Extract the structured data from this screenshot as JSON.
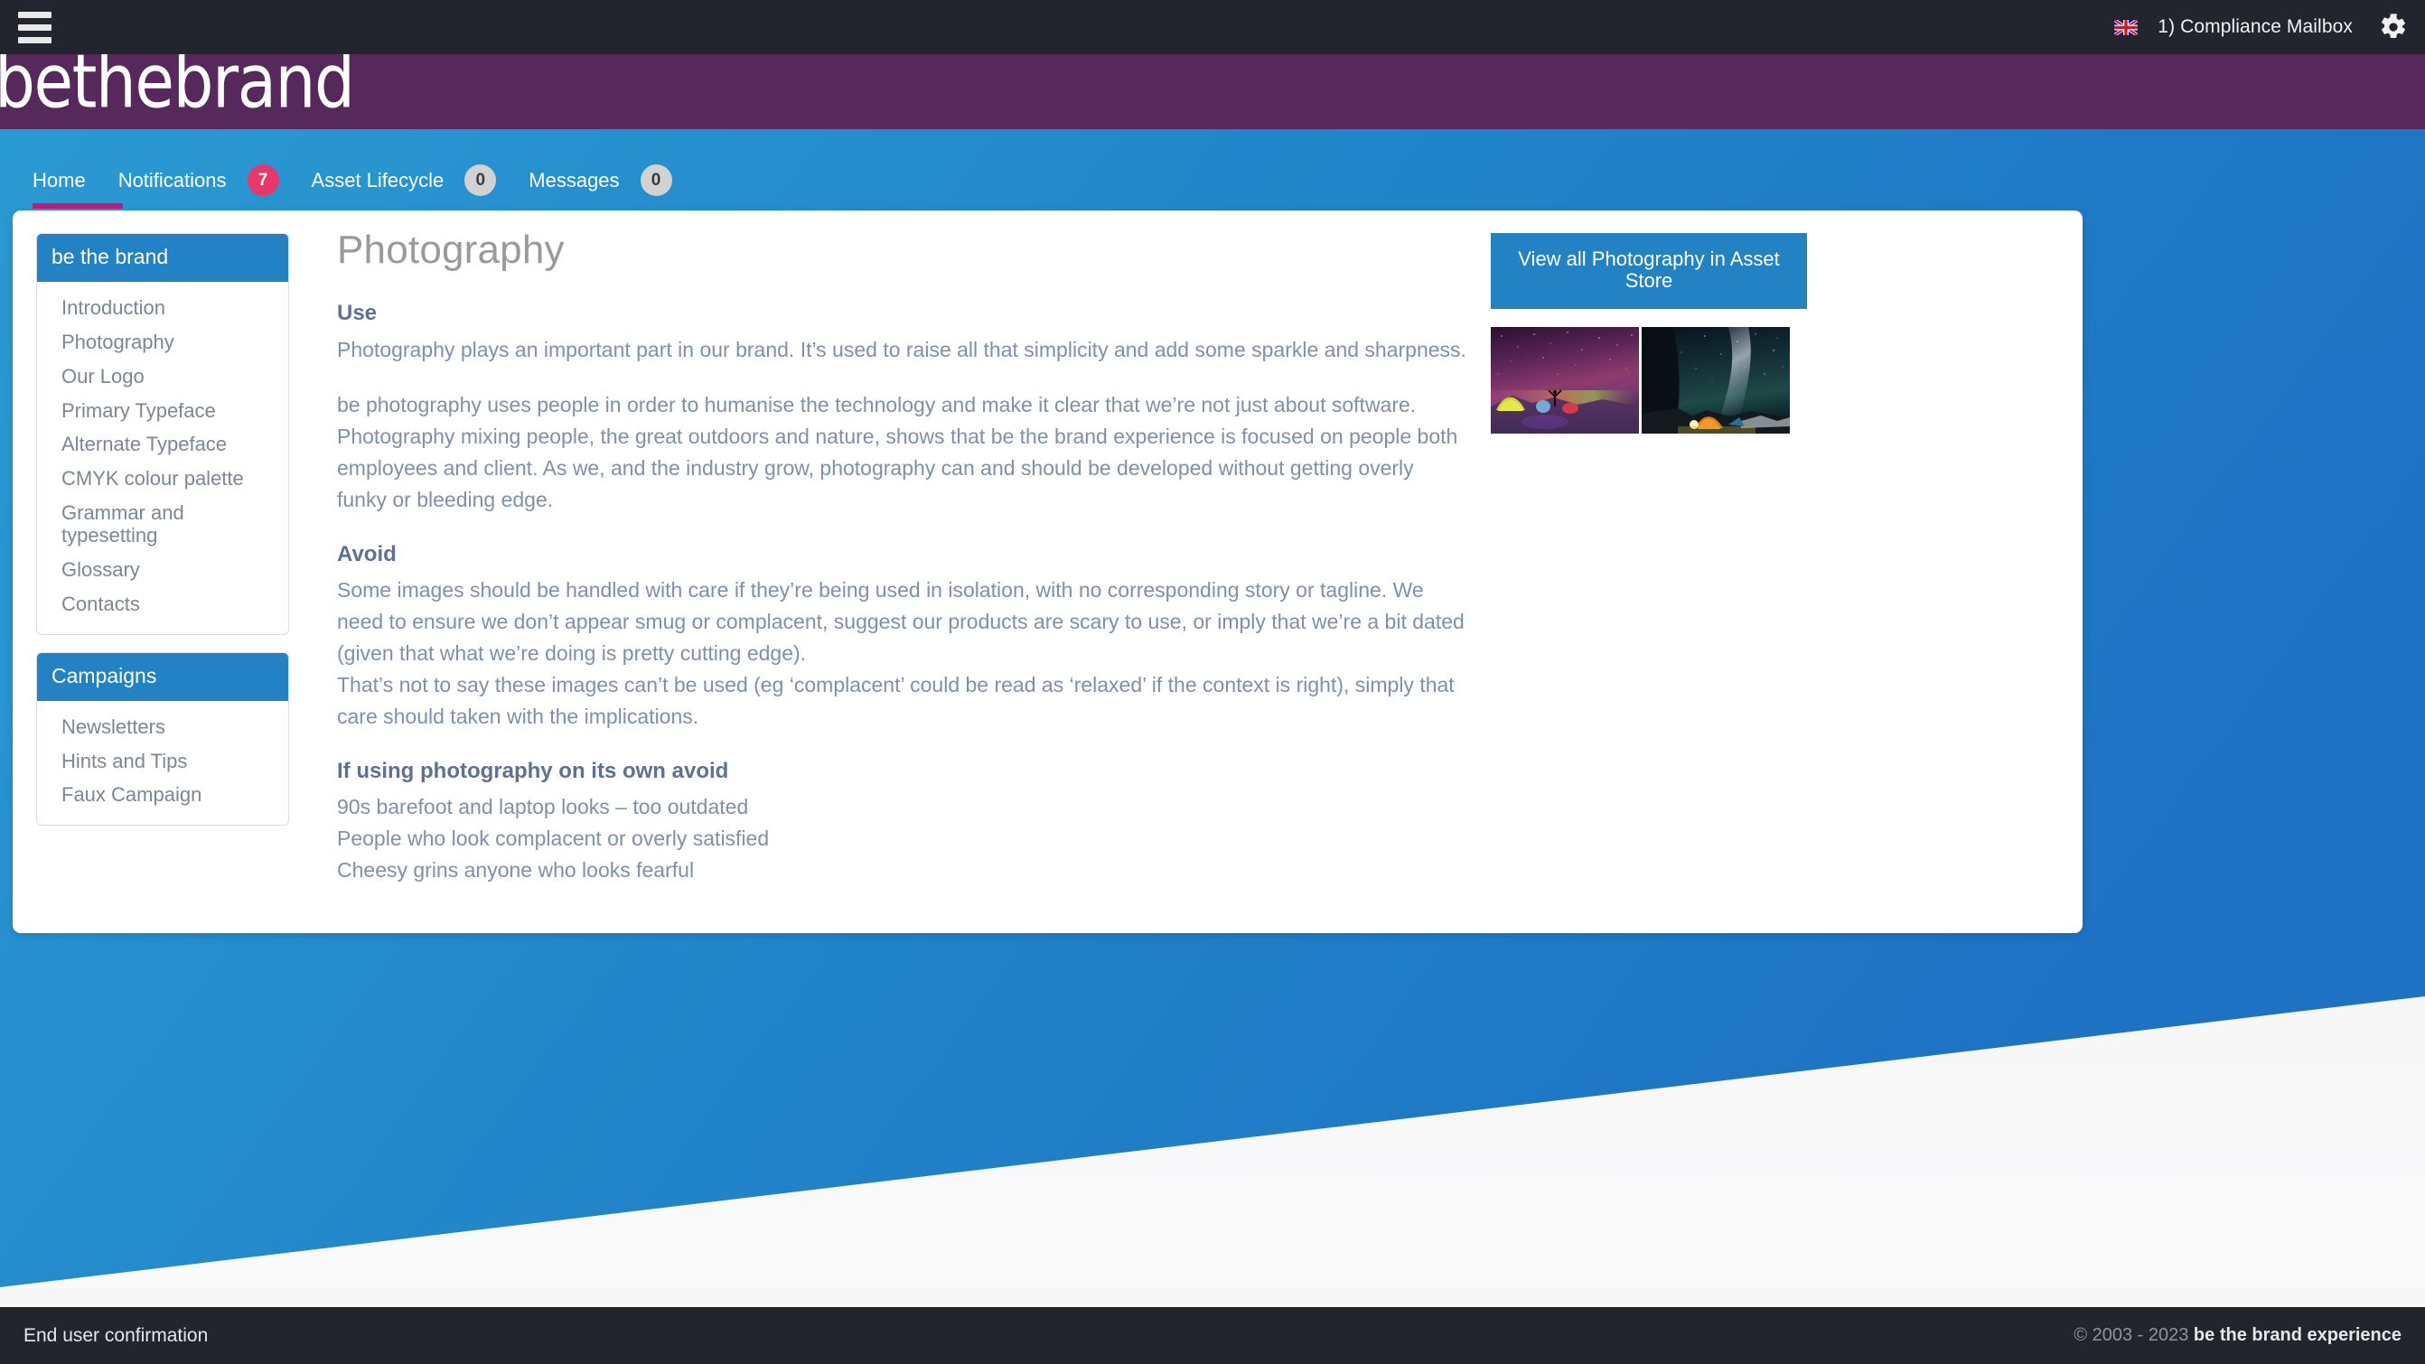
{
  "topbar": {
    "menu_icon": "hamburger-icon",
    "language": "en-GB",
    "mailbox_label": "1) Compliance Mailbox",
    "settings_icon": "gear-icon"
  },
  "brand": {
    "logo_text": "bethebrand",
    "brand_color": "#57285c"
  },
  "nav": {
    "accent_color": "#2a93d0",
    "active_underline_color": "#c0197d",
    "tabs": [
      {
        "label": "Home",
        "badge": null,
        "badge_style": "none",
        "active": true
      },
      {
        "label": "Notifications",
        "badge": "7",
        "badge_style": "pink",
        "active": false
      },
      {
        "label": "Asset Lifecycle",
        "badge": "0",
        "badge_style": "grey",
        "active": false
      },
      {
        "label": "Messages",
        "badge": "0",
        "badge_style": "grey",
        "active": false
      }
    ]
  },
  "sidebar": {
    "groups": [
      {
        "title": "be the brand",
        "items": [
          "Introduction",
          "Photography",
          "Our Logo",
          "Primary Typeface",
          "Alternate Typeface",
          "CMYK colour palette",
          "Grammar and typesetting",
          "Glossary",
          "Contacts"
        ]
      },
      {
        "title": "Campaigns",
        "items": [
          "Newsletters",
          "Hints and Tips",
          "Faux Campaign"
        ]
      }
    ]
  },
  "article": {
    "title": "Photography",
    "use_heading": "Use",
    "use_para_1": "Photography plays an important part in our brand. It’s used to raise all that simplicity and add some sparkle and sharpness.",
    "use_para_2": "be photography uses people in order to humanise the technology and make it clear that we’re not just about software. Photography mixing people, the great outdoors and nature, shows that be the brand experience is focused on people both employees and client. As we, and the industry grow, photography can and should be developed without getting overly funky or bleeding edge.",
    "avoid_heading": "Avoid",
    "avoid_para_1": "Some images should be handled with care if they’re being used in isolation, with no corresponding story or tagline. We need to ensure we don’t appear smug or complacent, suggest our products are scary to use, or imply that we’re a bit dated (given that what we’re doing is pretty cutting edge).",
    "avoid_para_2": "That’s not to say these images can’t be used (eg ‘complacent’ could be read as ‘relaxed’ if the context is right), simply that care should taken with the implications.",
    "own_heading": "If using photography on its own avoid",
    "own_item_1": "90s barefoot and laptop looks – too outdated",
    "own_item_2": "People who look complacent or overly satisfied",
    "own_item_3": "Cheesy grins anyone who looks fearful"
  },
  "rail": {
    "asset_store_button": "View all Photography in Asset Store",
    "thumbnails": [
      {
        "name": "aurora-camping-thumbnail"
      },
      {
        "name": "milky-way-camping-thumbnail"
      }
    ]
  },
  "footer": {
    "left_link": "End user confirmation",
    "copyright_prefix": "© 2003 - 2023 ",
    "copyright_brand": "be the brand experience"
  }
}
